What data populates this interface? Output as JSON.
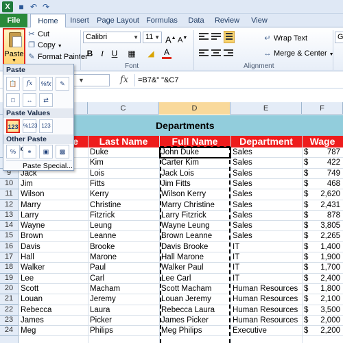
{
  "window": {
    "logo": "X",
    "qat_icons": [
      "save-icon",
      "undo-icon",
      "redo-icon"
    ]
  },
  "ribbon_tabs": [
    "File",
    "Home",
    "Insert",
    "Page Layout",
    "Formulas",
    "Data",
    "Review",
    "View"
  ],
  "clipboard": {
    "paste_label": "Paste",
    "cut_label": "Cut",
    "copy_label": "Copy",
    "format_painter_label": "Format Painter"
  },
  "font": {
    "name": "Calibri",
    "size": "11",
    "bold": "B",
    "italic": "I",
    "underline": "U",
    "font_color": "A",
    "group_label": "Font"
  },
  "alignment": {
    "wrap_text_label": "Wrap Text",
    "merge_center_label": "Merge & Center",
    "group_label": "Alignment"
  },
  "number": {
    "format_label": "Ge"
  },
  "formula_bar": {
    "fx": "fx",
    "formula": "=B7&\" \"&C7"
  },
  "paste_menu": {
    "paste_header": "Paste",
    "paste_values_header": "Paste Values",
    "other_header": "Other Paste Options",
    "paste_special_label": "Paste Special...",
    "paste_icons": [
      "clipboard",
      "fx",
      "%fx",
      "pencil",
      "no-border",
      "keep-width",
      "transpose"
    ],
    "values_icons": [
      "123",
      "%123",
      "brush123"
    ],
    "other_icons": [
      "%",
      "link",
      "picture",
      "linked-picture"
    ]
  },
  "columns": [
    "C",
    "D",
    "E",
    "F"
  ],
  "selected_column": "D",
  "sheet": {
    "title": "Departments",
    "headers": [
      "Last Name",
      "Full Name",
      "Department",
      "Wage"
    ],
    "header_partial_first": "e",
    "rows": [
      {
        "row": "",
        "first": "",
        "last": "Duke",
        "full": "John Duke",
        "dept": "Sales",
        "cur": "$",
        "wage": "787"
      },
      {
        "row": "",
        "first": "",
        "last": "Kim",
        "full": "Carter Kim",
        "dept": "Sales",
        "cur": "$",
        "wage": "422"
      },
      {
        "row": "9",
        "first": "Jack",
        "last": "Lois",
        "full": "Jack Lois",
        "dept": "Sales",
        "cur": "$",
        "wage": "749"
      },
      {
        "row": "10",
        "first": "Jim",
        "last": "Fitts",
        "full": "Jim Fitts",
        "dept": "Sales",
        "cur": "$",
        "wage": "468"
      },
      {
        "row": "11",
        "first": "Wilson",
        "last": "Kerry",
        "full": "Wilson Kerry",
        "dept": "Sales",
        "cur": "$",
        "wage": "2,620"
      },
      {
        "row": "12",
        "first": "Marry",
        "last": "Christine",
        "full": "Marry Christine",
        "dept": "Sales",
        "cur": "$",
        "wage": "2,431"
      },
      {
        "row": "13",
        "first": "Larry",
        "last": "Fitzrick",
        "full": "Larry Fitzrick",
        "dept": "Sales",
        "cur": "$",
        "wage": "878"
      },
      {
        "row": "14",
        "first": "Wayne",
        "last": "Leung",
        "full": "Wayne Leung",
        "dept": "Sales",
        "cur": "$",
        "wage": "3,805"
      },
      {
        "row": "15",
        "first": "Brown",
        "last": "Leanne",
        "full": "Brown Leanne",
        "dept": "Sales",
        "cur": "$",
        "wage": "2,265"
      },
      {
        "row": "16",
        "first": "Davis",
        "last": "Brooke",
        "full": "Davis Brooke",
        "dept": "IT",
        "cur": "$",
        "wage": "1,400"
      },
      {
        "row": "17",
        "first": "Hall",
        "last": "Marone",
        "full": "Hall Marone",
        "dept": "IT",
        "cur": "$",
        "wage": "1,900"
      },
      {
        "row": "18",
        "first": "Walker",
        "last": "Paul",
        "full": "Walker Paul",
        "dept": "IT",
        "cur": "$",
        "wage": "1,700"
      },
      {
        "row": "19",
        "first": "Lee",
        "last": "Carl",
        "full": "Lee Carl",
        "dept": "IT",
        "cur": "$",
        "wage": "2,400"
      },
      {
        "row": "20",
        "first": "Scott",
        "last": "Macham",
        "full": "Scott Macham",
        "dept": "Human Resources",
        "cur": "$",
        "wage": "1,800"
      },
      {
        "row": "21",
        "first": "Louan",
        "last": "Jeremy",
        "full": "Louan Jeremy",
        "dept": "Human Resources",
        "cur": "$",
        "wage": "2,100"
      },
      {
        "row": "22",
        "first": "Rebecca",
        "last": "Laura",
        "full": "Rebecca Laura",
        "dept": "Human Resources",
        "cur": "$",
        "wage": "3,500"
      },
      {
        "row": "23",
        "first": "James",
        "last": "Picker",
        "full": "James Picker",
        "dept": "Human Resources",
        "cur": "$",
        "wage": "2,000"
      },
      {
        "row": "24",
        "first": "Meg",
        "last": "Philips",
        "full": "Meg Philips",
        "dept": "Executive",
        "cur": "$",
        "wage": "2,200"
      }
    ]
  },
  "colors": {
    "banner": "#92cddc",
    "header_red": "#ee1c1c",
    "file_tab": "#2a8a3b",
    "highlight": "#e0291c"
  }
}
